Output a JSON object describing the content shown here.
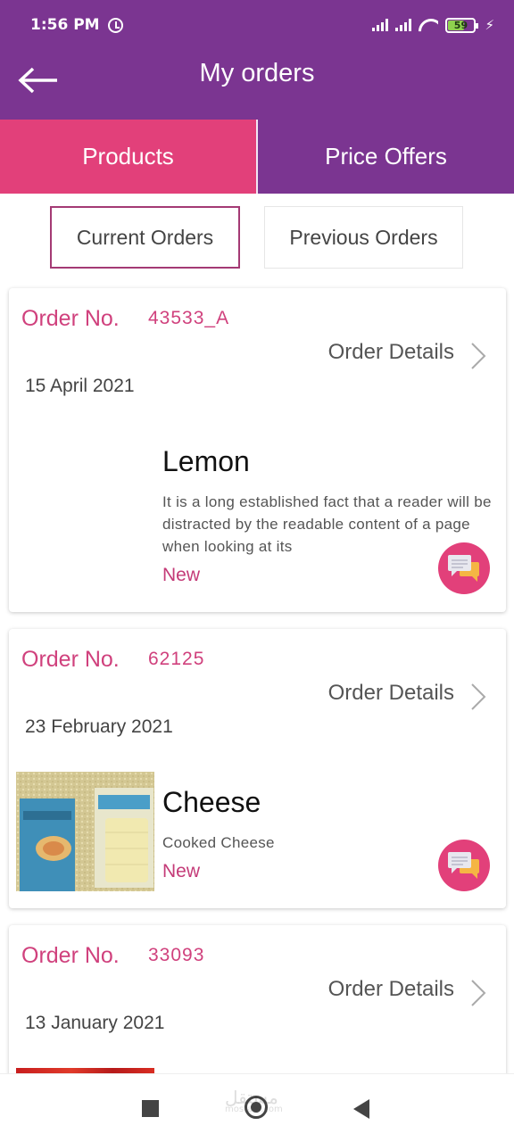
{
  "status_bar": {
    "time": "1:56 PM",
    "battery_level": "59",
    "battery_fraction": 0.59,
    "icons": [
      "alarm-icon",
      "signal-icon",
      "signal-icon",
      "wifi-icon",
      "battery-icon",
      "charging-icon"
    ]
  },
  "header": {
    "title": "My orders",
    "back_icon": "arrow-left-icon"
  },
  "tabs": [
    {
      "label": "Products",
      "active": true
    },
    {
      "label": "Price Offers",
      "active": false
    }
  ],
  "segments": [
    {
      "label": "Current Orders",
      "selected": true
    },
    {
      "label": "Previous Orders",
      "selected": false
    }
  ],
  "orders": [
    {
      "order_label": "Order No.",
      "order_number": "43533_A",
      "details_label": "Order Details",
      "date": "15 April 2021",
      "product_name": "Lemon",
      "product_description": "It is a long established fact that a reader will be distracted by the readable content of a page when looking at its",
      "status": "New"
    },
    {
      "order_label": "Order No.",
      "order_number": "62125",
      "details_label": "Order Details",
      "date": "23 February 2021",
      "product_name": "Cheese",
      "product_description": "Cooked Cheese",
      "status": "New"
    },
    {
      "order_label": "Order No.",
      "order_number": "33093",
      "details_label": "Order Details",
      "date": "13 January 2021"
    }
  ],
  "colors": {
    "primary_purple": "#7b3591",
    "accent_pink": "#e2407a",
    "order_text_pink": "#d0417d"
  },
  "nav_bar": {
    "icons": [
      "recents-square-icon",
      "home-circle-icon",
      "back-triangle-icon"
    ],
    "watermark": "مستقل",
    "watermark_sub": "mostaql.com"
  }
}
